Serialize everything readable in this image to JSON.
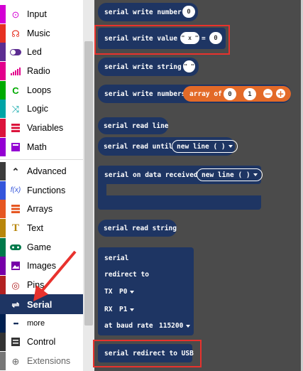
{
  "toolbox": {
    "categories": [
      {
        "label": "Input",
        "color": "#d400d4",
        "icon": "target-icon"
      },
      {
        "label": "Music",
        "color": "#e63022",
        "icon": "headphones-icon"
      },
      {
        "label": "Led",
        "color": "#5c2d91",
        "icon": "toggle-icon"
      },
      {
        "label": "Radio",
        "color": "#e3008c",
        "icon": "signal-bars-icon"
      },
      {
        "label": "Loops",
        "color": "#00aa00",
        "icon": "refresh-icon"
      },
      {
        "label": "Logic",
        "color": "#00a4a6",
        "icon": "shuffle-icon"
      },
      {
        "label": "Variables",
        "color": "#dc143c",
        "icon": "list-icon"
      },
      {
        "label": "Math",
        "color": "#9400d3",
        "icon": "calculator-icon"
      },
      {
        "label": "Advanced",
        "color": "#3c3c3c",
        "icon": "chevron-up-icon"
      },
      {
        "label": "Functions",
        "color": "#3455db",
        "icon": "function-icon"
      },
      {
        "label": "Arrays",
        "color": "#e65722",
        "icon": "array-icon"
      },
      {
        "label": "Text",
        "color": "#b8860b",
        "icon": "text-icon"
      },
      {
        "label": "Game",
        "color": "#007a4b",
        "icon": "gamepad-icon"
      },
      {
        "label": "Images",
        "color": "#7600a8",
        "icon": "image-icon"
      },
      {
        "label": "Pins",
        "color": "#b22222",
        "icon": "target-circle-icon"
      },
      {
        "label": "Serial",
        "color": "#002050",
        "icon": "usb-icon"
      },
      {
        "label": "more",
        "color": "#002050",
        "icon": "ellipsis-icon"
      },
      {
        "label": "Control",
        "color": "#333333",
        "icon": "control-icon"
      },
      {
        "label": "Extensions",
        "color": "#777777",
        "icon": "plus-circle-icon"
      }
    ]
  },
  "icons": {
    "input": "⊙",
    "music": "☊",
    "loops": "C",
    "logic": "⤨",
    "advanced": "⌃",
    "functions": "f(x)",
    "text": "T",
    "pins": "◎",
    "serial": "⇌",
    "more": "•••",
    "extensions": "⊕"
  },
  "blocks": {
    "write_number": {
      "label": "serial write number",
      "value": "0"
    },
    "write_value": {
      "label": "serial write value",
      "name": "\" x \"",
      "eq": "=",
      "value": "0"
    },
    "write_string": {
      "label": "serial write string",
      "value": "\" \""
    },
    "write_numbers": {
      "label": "serial write numbers",
      "array_label": "array of",
      "values": [
        "0",
        "1"
      ],
      "minus": "−",
      "plus": "+"
    },
    "read_line": {
      "label": "serial read line"
    },
    "read_until": {
      "label": "serial read until",
      "option": "new line ( )"
    },
    "on_data": {
      "label": "serial on data received",
      "option": "new line ( )"
    },
    "read_string": {
      "label": "serial read string"
    },
    "redirect": {
      "line1": "serial",
      "line2": "redirect to",
      "tx_label": "TX",
      "tx": "P0",
      "rx_label": "RX",
      "rx": "P1",
      "baud_label": "at baud rate",
      "baud": "115200"
    },
    "redirect_usb": {
      "label": "serial redirect to USB"
    }
  },
  "colors": {
    "serial_block": "#1e3563",
    "flyout_bg": "#4b4b4b",
    "array_block": "#e36a28",
    "highlight": "#e8322d"
  }
}
